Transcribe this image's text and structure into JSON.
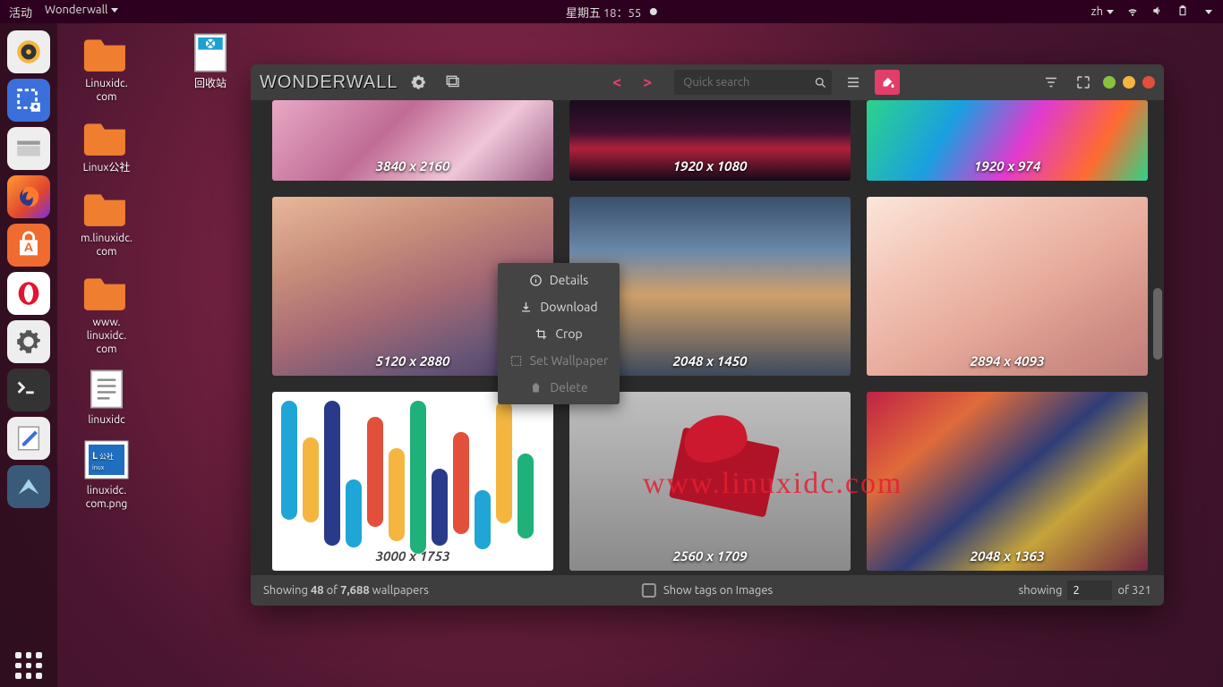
{
  "topbar": {
    "activities": "活动",
    "app_menu": "Wonderwall",
    "clock": "星期五 18：55",
    "lang": "zh"
  },
  "dock": {
    "items": [
      "rhythmbox",
      "screenshot",
      "files",
      "firefox",
      "software",
      "opera",
      "settings",
      "terminal",
      "text-editor",
      "wonderwall"
    ]
  },
  "desktop": {
    "col1": [
      {
        "label": "Linuxidc.\ncom"
      },
      {
        "label": "Linux公社"
      },
      {
        "label": "m.linuxidc.\ncom"
      },
      {
        "label": "www.\nlinuxidc.\ncom"
      },
      {
        "label": "linuxidc"
      },
      {
        "label": "linuxidc.\ncom.png"
      }
    ],
    "col2": [
      {
        "label": "回收站"
      }
    ]
  },
  "win": {
    "logo": "WONDERWALL",
    "search_placeholder": "Quick search",
    "grid": [
      {
        "res": "3840 x 2160"
      },
      {
        "res": "1920 x 1080"
      },
      {
        "res": "1920 x 974"
      },
      {
        "res": "5120 x 2880"
      },
      {
        "res": "2048 x 1450"
      },
      {
        "res": "2894 x 4093"
      },
      {
        "res": "3000 x 1753"
      },
      {
        "res": "2560 x 1709"
      },
      {
        "res": "2048 x 1363"
      }
    ],
    "ctx": {
      "details": "Details",
      "download": "Download",
      "crop": "Crop",
      "set": "Set Wallpaper",
      "delete": "Delete"
    },
    "bottom": {
      "showing_pre": "Showing ",
      "count": "48",
      "of": " of  ",
      "total": "7,688",
      "suffix": " wallpapers",
      "tags": "Show tags on Images",
      "showing": "showing",
      "page": "2",
      "of_total": " of 321"
    }
  },
  "watermark": "www.linuxidc.com"
}
